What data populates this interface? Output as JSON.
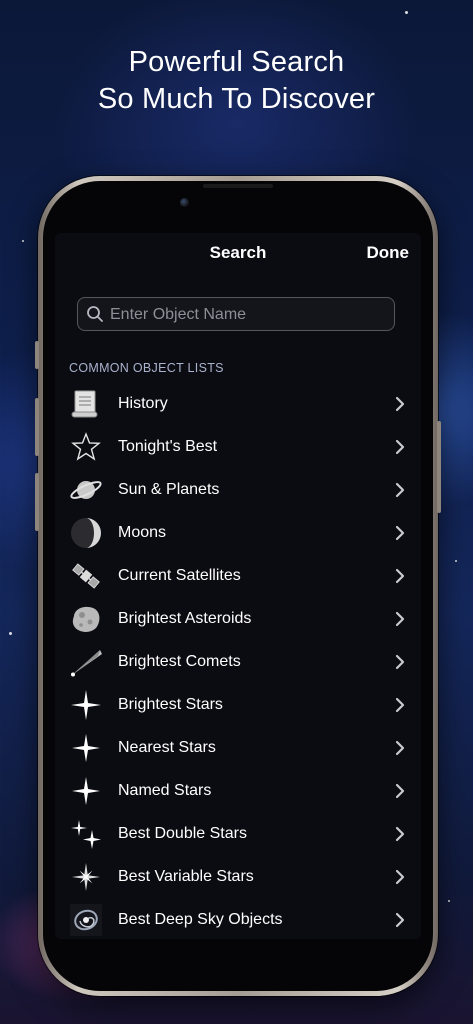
{
  "promo": {
    "line1": "Powerful Search",
    "line2": "So Much To Discover"
  },
  "nav": {
    "title": "Search",
    "done_label": "Done"
  },
  "search": {
    "placeholder": "Enter Object Name",
    "value": ""
  },
  "section": {
    "header": "COMMON OBJECT LISTS"
  },
  "lists": [
    {
      "label": "History",
      "icon": "scroll-icon"
    },
    {
      "label": "Tonight's Best",
      "icon": "star-outline-icon"
    },
    {
      "label": "Sun & Planets",
      "icon": "planet-icon"
    },
    {
      "label": "Moons",
      "icon": "moon-icon"
    },
    {
      "label": "Current Satellites",
      "icon": "satellite-icon"
    },
    {
      "label": "Brightest Asteroids",
      "icon": "asteroid-icon"
    },
    {
      "label": "Brightest Comets",
      "icon": "comet-icon"
    },
    {
      "label": "Brightest Stars",
      "icon": "bright-star-icon"
    },
    {
      "label": "Nearest Stars",
      "icon": "near-star-icon"
    },
    {
      "label": "Named Stars",
      "icon": "named-star-icon"
    },
    {
      "label": "Best Double Stars",
      "icon": "double-star-icon"
    },
    {
      "label": "Best Variable Stars",
      "icon": "variable-star-icon"
    },
    {
      "label": "Best Deep Sky Objects",
      "icon": "galaxy-icon"
    }
  ]
}
